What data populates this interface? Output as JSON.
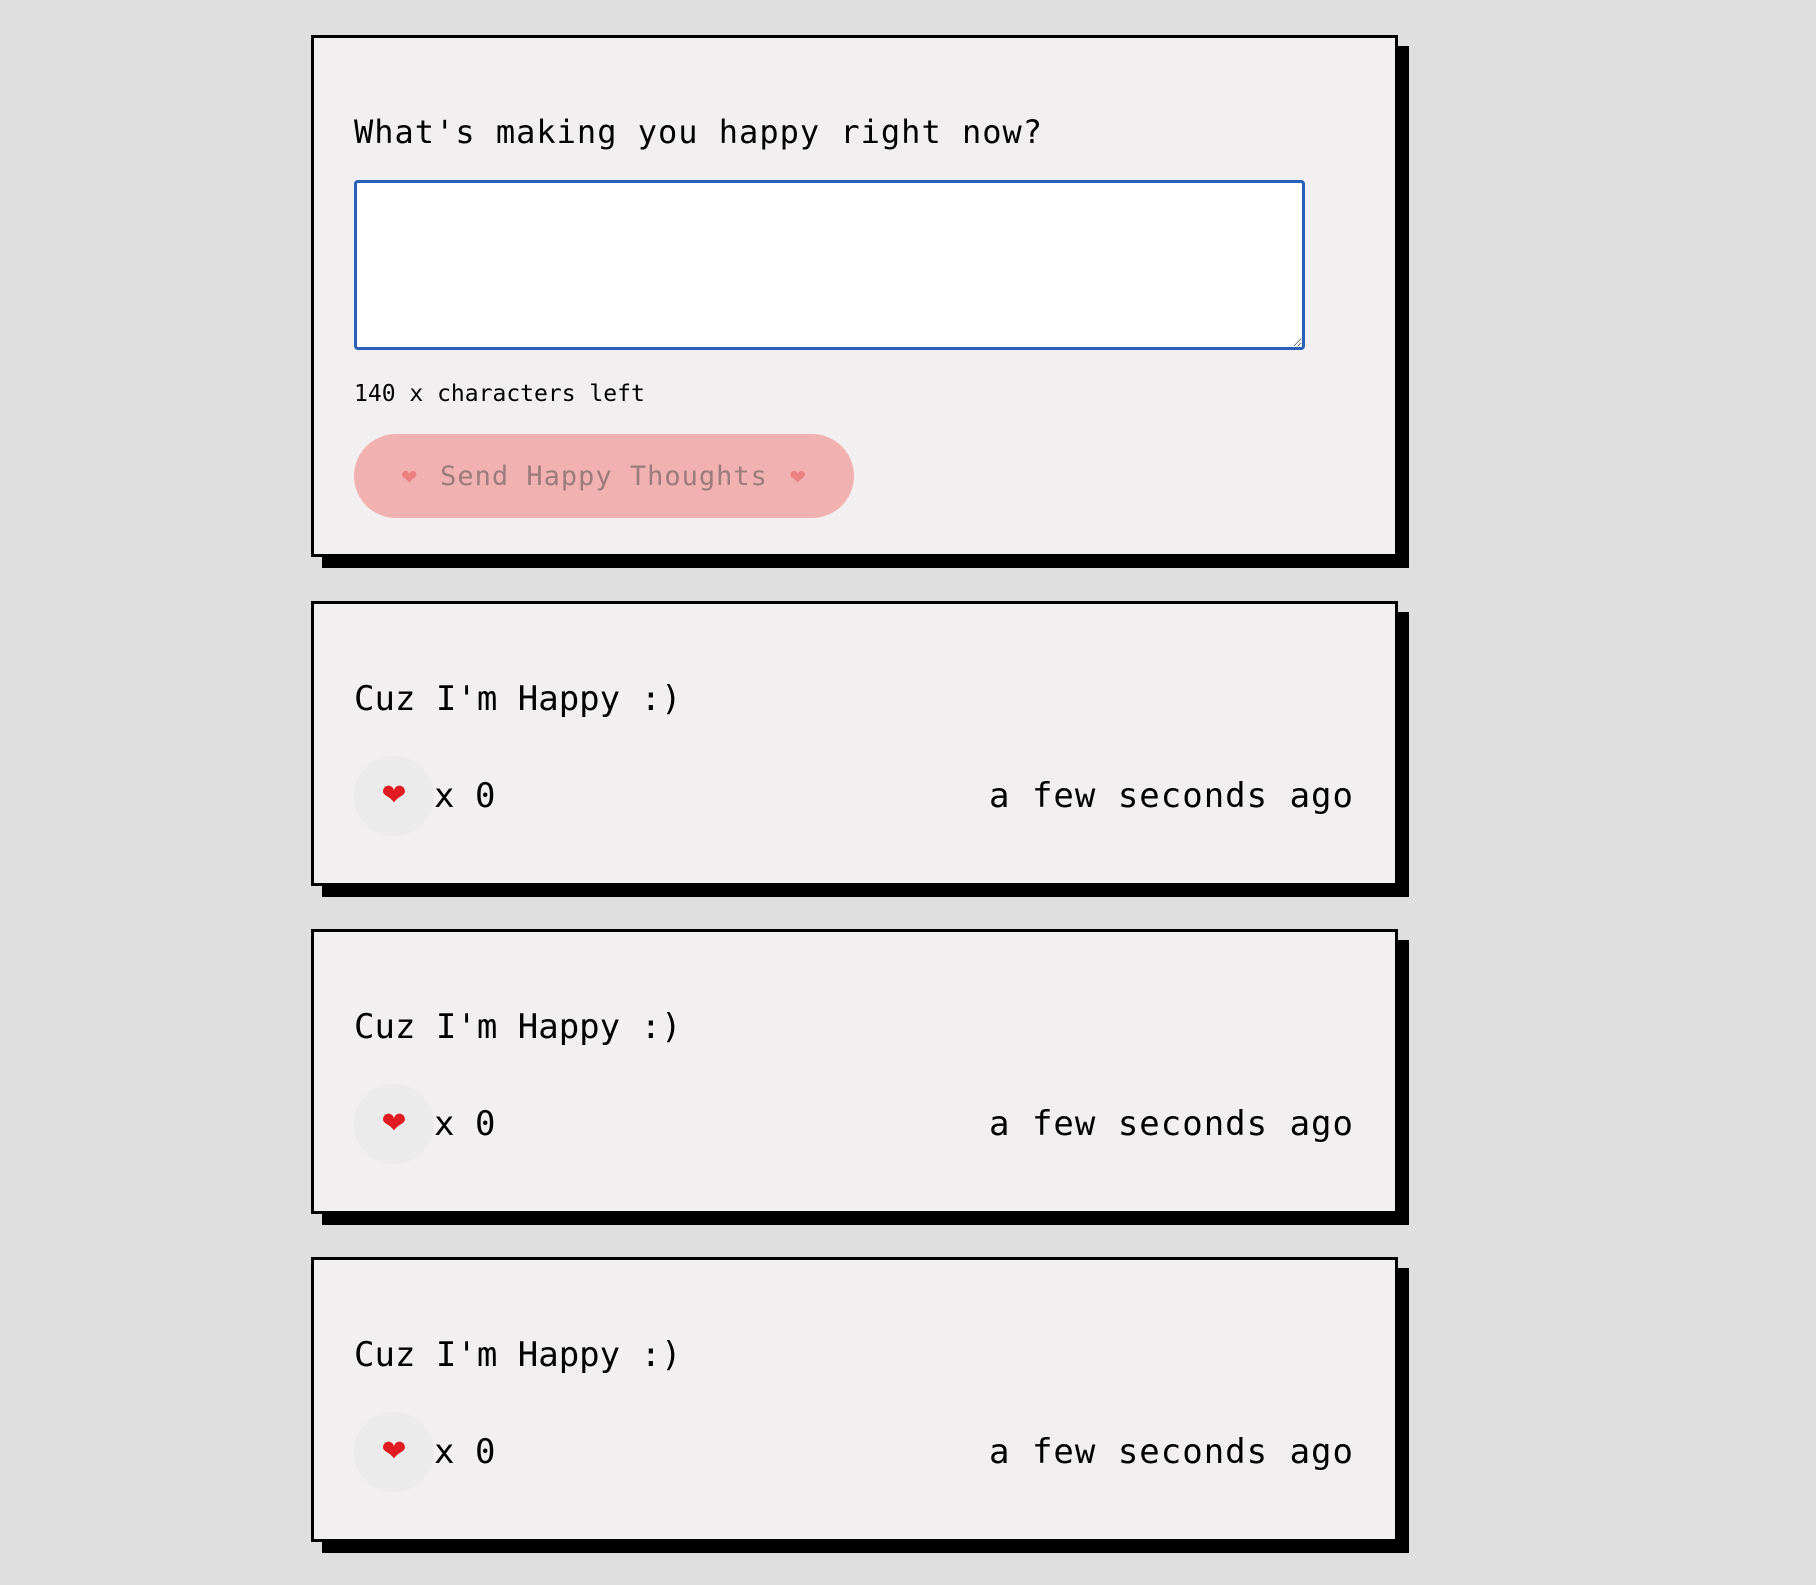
{
  "form": {
    "title": "What's making you happy right now?",
    "input_value": "",
    "input_placeholder": "",
    "char_count_text": "140 x characters left",
    "send_button": {
      "label": "Send Happy Thoughts",
      "left_icon": "heart-icon",
      "right_icon": "heart-icon",
      "heart_glyph": "❤"
    }
  },
  "thoughts": [
    {
      "message": "Cuz I'm Happy :)",
      "heart_glyph": "❤",
      "likes_text": "x 0",
      "time": "a few seconds ago"
    },
    {
      "message": "Cuz I'm Happy :)",
      "heart_glyph": "❤",
      "likes_text": "x 0",
      "time": "a few seconds ago"
    },
    {
      "message": "Cuz I'm Happy :)",
      "heart_glyph": "❤",
      "likes_text": "x 0",
      "time": "a few seconds ago"
    }
  ],
  "colors": {
    "page_background": "#e0dfe0",
    "card_background": "#f1eff0",
    "card_border": "#000000",
    "input_border": "#2b60b8",
    "send_button_background": "#f2b1b1",
    "send_button_text": "#9c7b7b",
    "heart": "#e01b22",
    "like_button_background": "#ecebeb"
  }
}
